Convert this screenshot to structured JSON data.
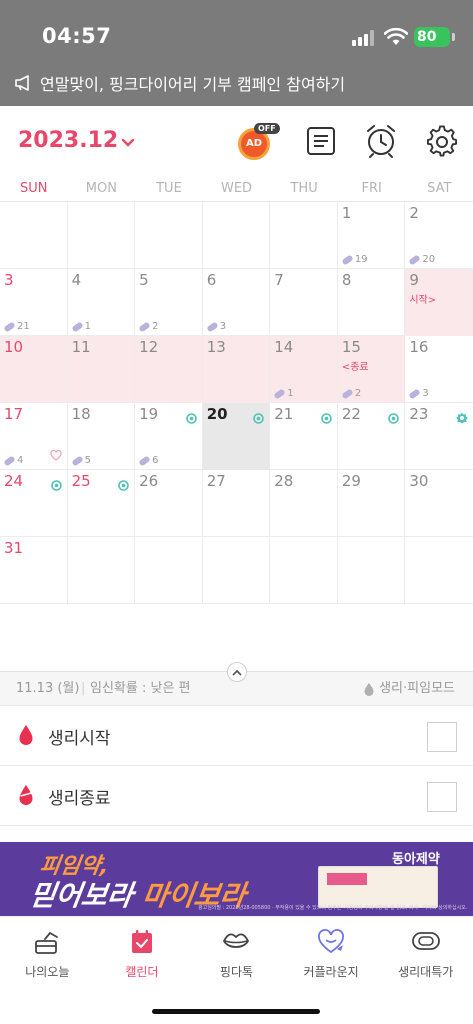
{
  "status": {
    "time": "04:57",
    "battery": "80"
  },
  "banner": {
    "text": "연말맞이, 핑크다이어리 기부 캠페인 참여하기"
  },
  "header": {
    "month": "2023.12",
    "ad_label": "AD",
    "ad_off": "OFF"
  },
  "weekdays": [
    "SUN",
    "MON",
    "TUE",
    "WED",
    "THU",
    "FRI",
    "SAT"
  ],
  "weeks": [
    [
      {
        "d": ""
      },
      {
        "d": ""
      },
      {
        "d": ""
      },
      {
        "d": ""
      },
      {
        "d": ""
      },
      {
        "d": "1",
        "pill": "19"
      },
      {
        "d": "2",
        "pill": "20"
      }
    ],
    [
      {
        "d": "3",
        "pill": "21"
      },
      {
        "d": "4",
        "pill": "1"
      },
      {
        "d": "5",
        "pill": "2"
      },
      {
        "d": "6",
        "pill": "3"
      },
      {
        "d": "7"
      },
      {
        "d": "8"
      },
      {
        "d": "9",
        "note": "시작>",
        "period": true
      }
    ],
    [
      {
        "d": "10",
        "period": true
      },
      {
        "d": "11",
        "period": true
      },
      {
        "d": "12",
        "period": true
      },
      {
        "d": "13",
        "period": true
      },
      {
        "d": "14",
        "period": true,
        "pill": "1"
      },
      {
        "d": "15",
        "period": true,
        "note": "<종료",
        "pill": "2"
      },
      {
        "d": "16",
        "pill": "3"
      }
    ],
    [
      {
        "d": "17",
        "pill": "4",
        "heart": true
      },
      {
        "d": "18",
        "pill": "5"
      },
      {
        "d": "19",
        "pill": "6",
        "ovu": true
      },
      {
        "d": "20",
        "today": true,
        "ovu": true
      },
      {
        "d": "21",
        "ovu": true
      },
      {
        "d": "22",
        "ovu": true
      },
      {
        "d": "23",
        "ovu_peak": true
      }
    ],
    [
      {
        "d": "24",
        "ovu": true
      },
      {
        "d": "25",
        "ovu": true,
        "holiday": true
      },
      {
        "d": "26"
      },
      {
        "d": "27"
      },
      {
        "d": "28"
      },
      {
        "d": "29"
      },
      {
        "d": "30"
      }
    ],
    [
      {
        "d": "31"
      },
      {
        "d": ""
      },
      {
        "d": ""
      },
      {
        "d": ""
      },
      {
        "d": ""
      },
      {
        "d": ""
      },
      {
        "d": ""
      }
    ]
  ],
  "info": {
    "date": "11.13 (월)",
    "separator": "|",
    "probability": "임신확률 : 낮은 편",
    "mode": "생리·피임모드"
  },
  "rows": [
    {
      "label": "생리시작"
    },
    {
      "label": "생리종료"
    }
  ],
  "ad": {
    "line1": "피임약,",
    "line2a": "믿어보라 ",
    "line2b": "마이보라",
    "brand": "동아제약",
    "fine": "광고심의필 : 2022년28-005800 · 부작용이 있을 수 있으니 첨부된 '사용상의 주의사항'을 잘 읽고, 의사 · 약사와 상의하십시오."
  },
  "tabs": [
    {
      "label": "나의오늘",
      "icon": "today-icon"
    },
    {
      "label": "캘린더",
      "icon": "calendar-icon"
    },
    {
      "label": "핑다톡",
      "icon": "lips-icon"
    },
    {
      "label": "커플라운지",
      "icon": "couple-heart-icon"
    },
    {
      "label": "생리대특가",
      "icon": "pad-icon"
    }
  ],
  "colors": {
    "accent": "#e8476a",
    "period": "#fbe8ea",
    "ovulation": "#4fc3b5"
  }
}
